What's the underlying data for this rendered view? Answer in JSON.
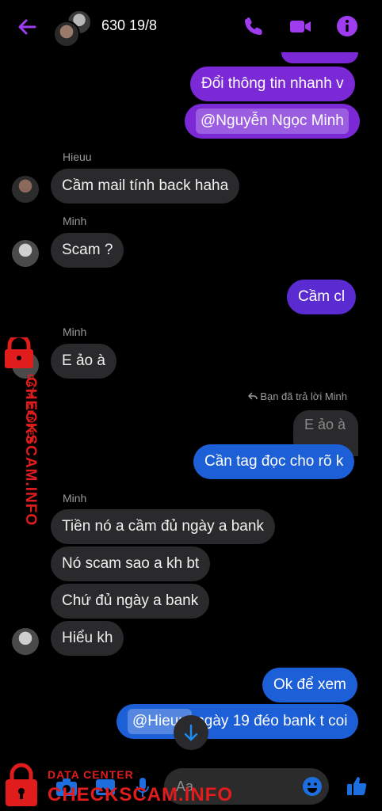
{
  "header": {
    "title": "630 19/8"
  },
  "messages": {
    "m1": "Đổi thông tin nhanh v",
    "m2_mention": "@Nguyễn Ngọc Minh",
    "sender_hieuu": "Hieuu",
    "m3": "Cầm mail tính back haha",
    "sender_minh_1": "Minh",
    "m4": "Scam ?",
    "m5": "Cầm cl",
    "sender_minh_2": "Minh",
    "m6": "E ảo à",
    "reply_note": "Bạn đã trả lời Minh",
    "reply_quote": "E ảo à",
    "m7": "Cần tag đọc cho rõ k",
    "sender_minh_3": "Minh",
    "m8": "Tiền nó a cầm đủ ngày a bank",
    "m9": "Nó scam sao a kh bt",
    "m10": "Chứ đủ ngày a bank",
    "m11": "Hiểu kh",
    "m12": "Ok để xem",
    "m13_mention": "@Hieuu",
    "m13_rest": "ngày 19 đéo bank t coi"
  },
  "composer": {
    "placeholder": "Aa"
  },
  "watermark": {
    "top_label": "DATA CENTER",
    "top_brand": "CHECKSCAM.INFO",
    "bottom_label": "DATA CENTER",
    "bottom_brand": "CHECKSCAM.INFO"
  },
  "colors": {
    "accent": "#a03cf0",
    "outgoing_purple": "#7b28d6",
    "outgoing_blue": "#1d5fd6",
    "incoming": "#2a2a2c",
    "watermark": "#e01c1c"
  },
  "icons": [
    "back-arrow-icon",
    "phone-icon",
    "video-icon",
    "info-icon",
    "camera-icon",
    "image-icon",
    "mic-icon",
    "emoji-icon",
    "thumbs-up-icon",
    "reply-icon",
    "chevron-down-icon",
    "lock-icon"
  ]
}
